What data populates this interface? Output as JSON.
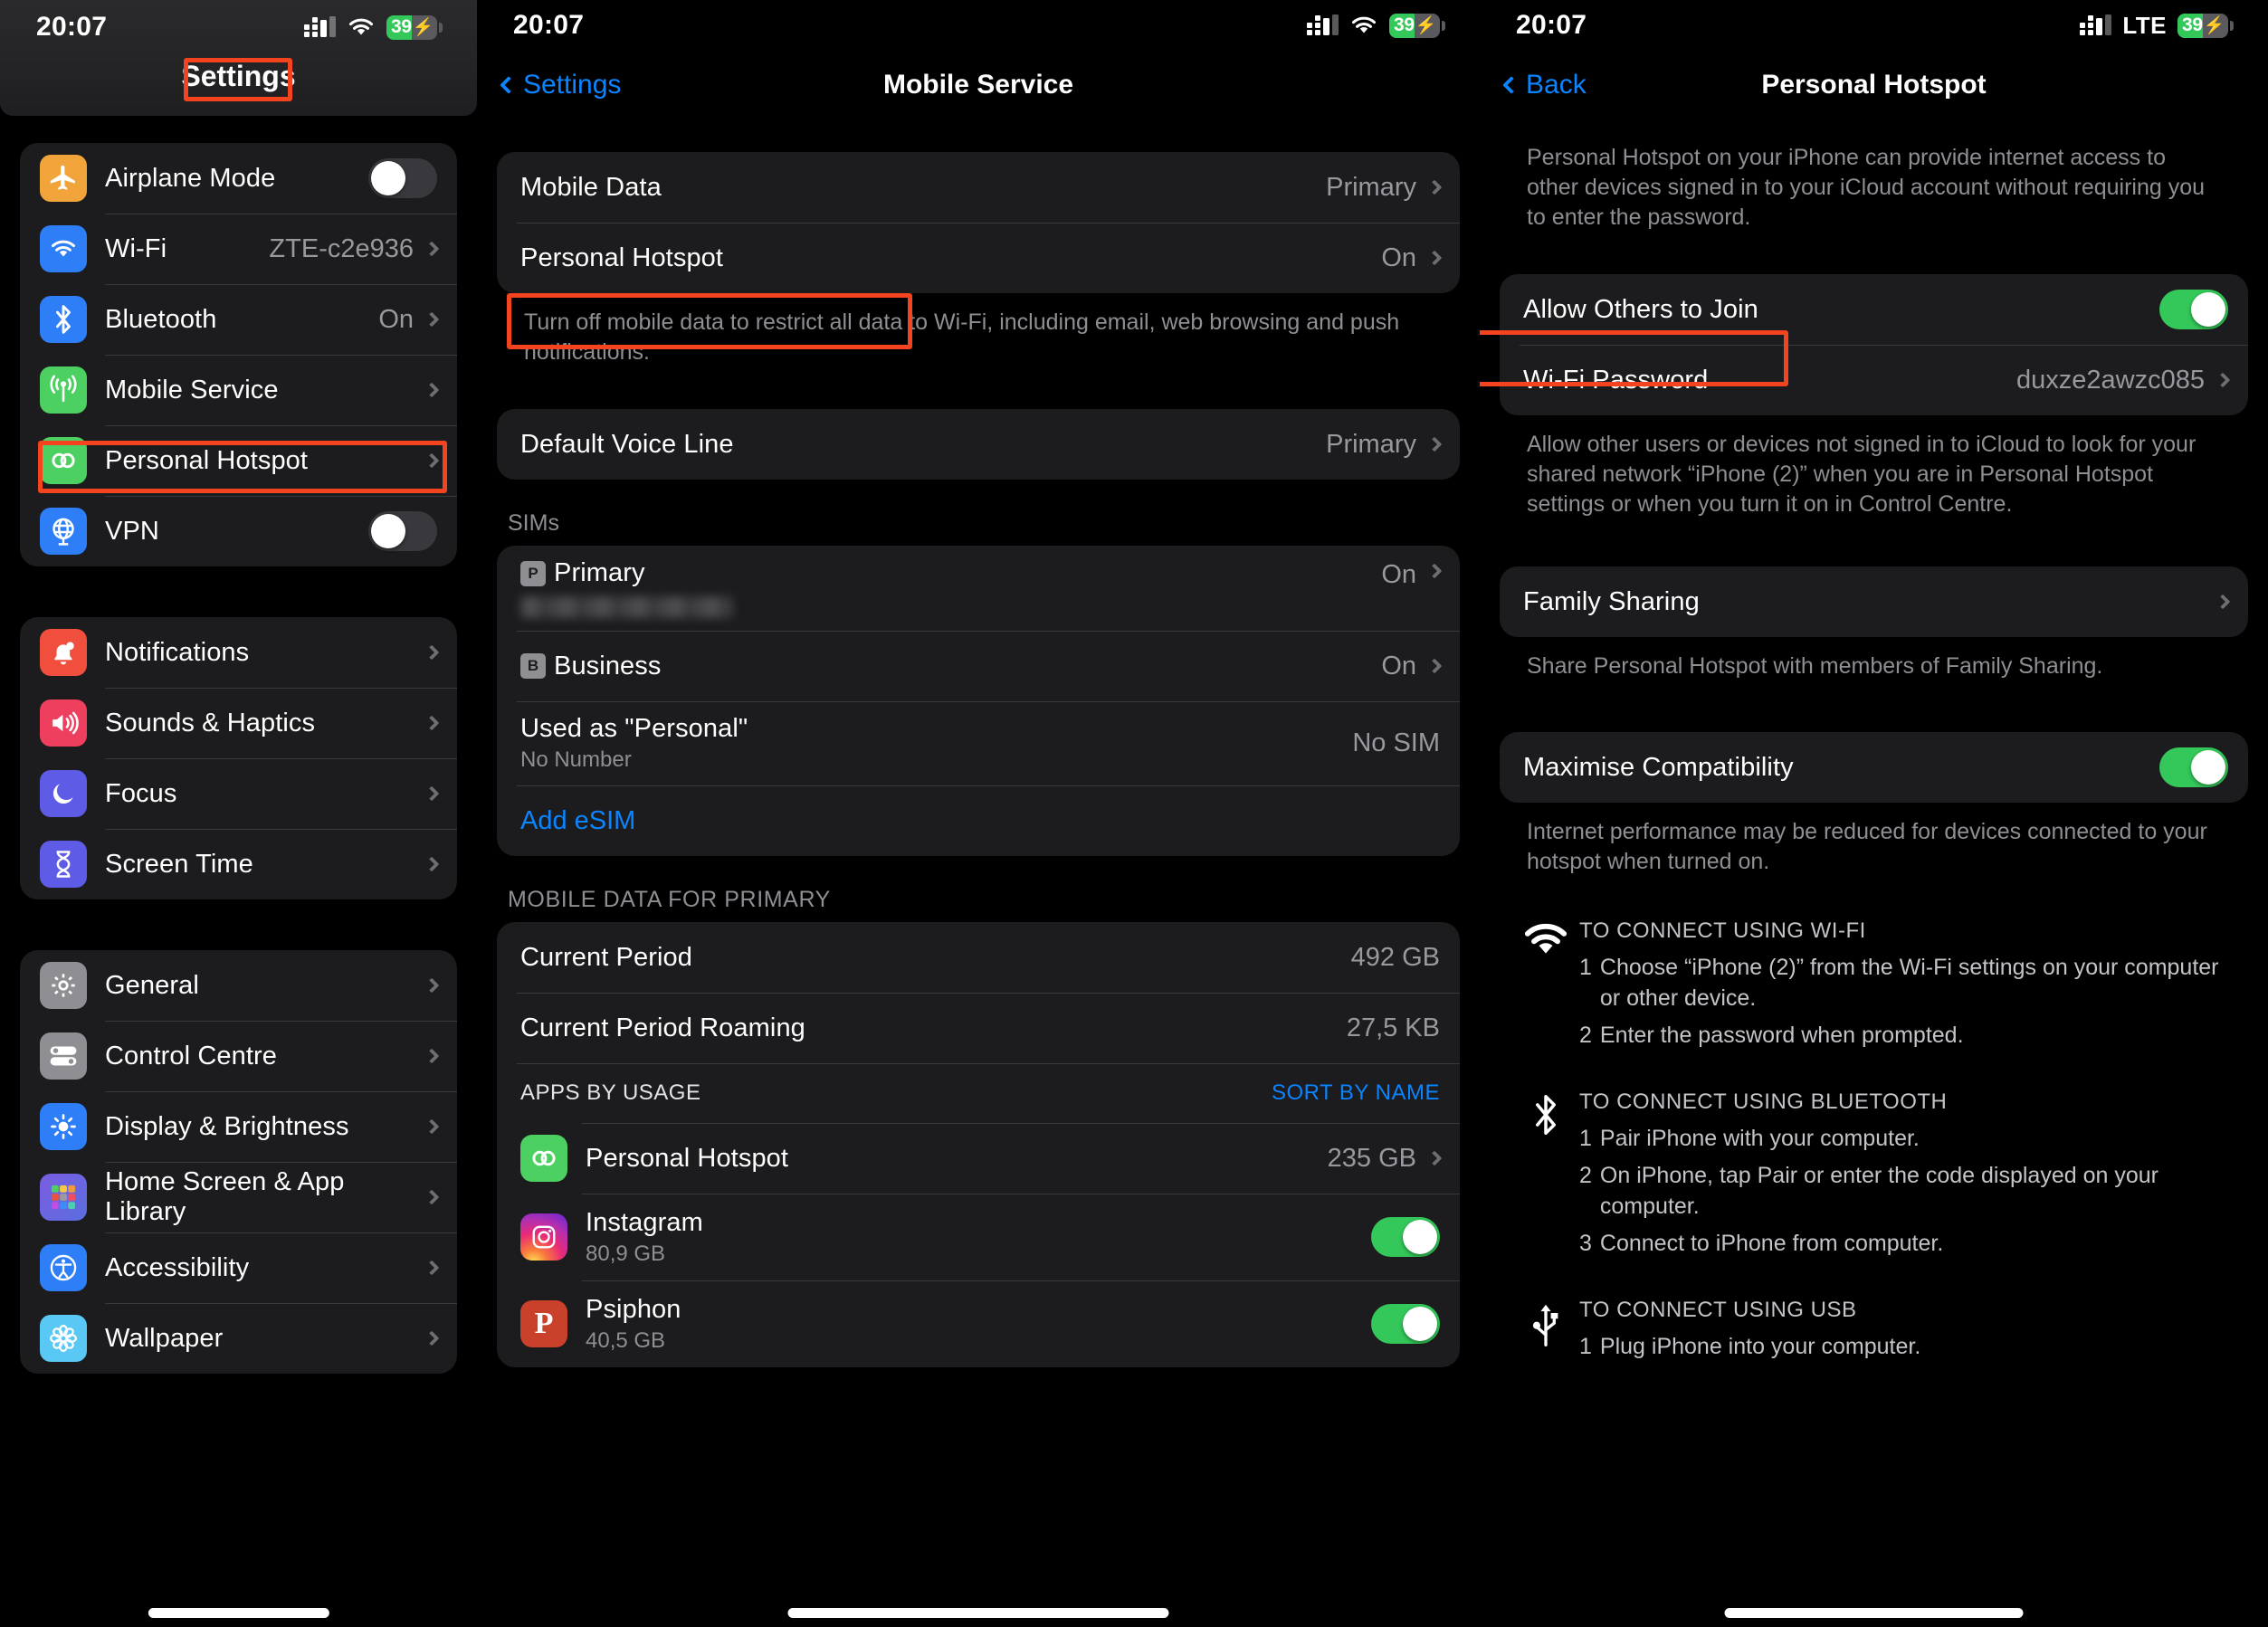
{
  "status_bar": {
    "time": "20:07",
    "battery_percent": "39",
    "battery_bolt": "⚡",
    "carrier_label_screen3": "LTE"
  },
  "screen1": {
    "title": "Settings",
    "groups": [
      {
        "rows": [
          {
            "label": "Airplane Mode",
            "icon": "airplane-icon",
            "icon_color": "#f0a43a",
            "control": "toggle",
            "toggle_on": false
          },
          {
            "label": "Wi-Fi",
            "icon": "wifi-icon",
            "icon_color": "#2e7ef7",
            "value": "ZTE-c2e936",
            "control": "chevron"
          },
          {
            "label": "Bluetooth",
            "icon": "bluetooth-icon",
            "icon_color": "#2e7ef7",
            "value": "On",
            "control": "chevron"
          },
          {
            "label": "Mobile Service",
            "icon": "cellular-antenna-icon",
            "icon_color": "#4cd061",
            "control": "chevron",
            "highlighted": true
          },
          {
            "label": "Personal Hotspot",
            "icon": "hotspot-link-icon",
            "icon_color": "#4cd061",
            "control": "chevron"
          },
          {
            "label": "VPN",
            "icon": "vpn-globe-icon",
            "icon_color": "#2e7ef7",
            "control": "toggle",
            "toggle_on": false
          }
        ]
      },
      {
        "rows": [
          {
            "label": "Notifications",
            "icon": "bell-icon",
            "icon_color": "#ef4f3c",
            "control": "chevron"
          },
          {
            "label": "Sounds & Haptics",
            "icon": "speaker-icon",
            "icon_color": "#ee3f5e",
            "control": "chevron"
          },
          {
            "label": "Focus",
            "icon": "moon-icon",
            "icon_color": "#5e5ce6",
            "control": "chevron"
          },
          {
            "label": "Screen Time",
            "icon": "hourglass-icon",
            "icon_color": "#5e5ce6",
            "control": "chevron"
          }
        ]
      },
      {
        "rows": [
          {
            "label": "General",
            "icon": "gear-icon",
            "icon_color": "#8e8e93",
            "control": "chevron"
          },
          {
            "label": "Control Centre",
            "icon": "sliders-icon",
            "icon_color": "#8e8e93",
            "control": "chevron"
          },
          {
            "label": "Display & Brightness",
            "icon": "brightness-icon",
            "icon_color": "#2e7ef7",
            "control": "chevron"
          },
          {
            "label": "Home Screen & App Library",
            "icon": "app-grid-icon",
            "icon_color": "#6a5ae0",
            "control": "chevron"
          },
          {
            "label": "Accessibility",
            "icon": "accessibility-icon",
            "icon_color": "#2e7ef7",
            "control": "chevron"
          },
          {
            "label": "Wallpaper",
            "icon": "flower-icon",
            "icon_color": "#5ac8f5",
            "control": "chevron"
          }
        ]
      }
    ]
  },
  "screen2": {
    "back_label": "Settings",
    "title": "Mobile Service",
    "group1": [
      {
        "label": "Mobile Data",
        "value": "Primary"
      },
      {
        "label": "Personal Hotspot",
        "value": "On",
        "highlighted": true
      }
    ],
    "footnote1": "Turn off mobile data to restrict all data to Wi-Fi, including email, web browsing and push notifications.",
    "group2": [
      {
        "label": "Default Voice Line",
        "value": "Primary"
      }
    ],
    "sims_header": "SIMs",
    "sims": [
      {
        "badge": "P",
        "label": "Primary",
        "value": "On",
        "redacted_number": true
      },
      {
        "badge": "B",
        "label": "Business",
        "value": "On"
      },
      {
        "label": "Used as \"Personal\"",
        "sub": "No Number",
        "value": "No SIM"
      }
    ],
    "add_esim": "Add eSIM",
    "data_header": "MOBILE DATA FOR PRIMARY",
    "data_rows": [
      {
        "label": "Current Period",
        "value": "492 GB"
      },
      {
        "label": "Current Period Roaming",
        "value": "27,5 KB"
      }
    ],
    "apps_header": "APPS BY USAGE",
    "apps_sort": "SORT BY NAME",
    "apps": [
      {
        "label": "Personal Hotspot",
        "value": "235 GB",
        "icon": "hotspot-link-icon",
        "control": "chevron"
      },
      {
        "label": "Instagram",
        "sub": "80,9 GB",
        "icon": "instagram-icon",
        "control": "toggle",
        "toggle_on": true
      },
      {
        "label": "Psiphon",
        "sub": "40,5 GB",
        "icon": "psiphon-icon",
        "control": "toggle",
        "toggle_on": true
      }
    ]
  },
  "screen3": {
    "back_label": "Back",
    "title": "Personal Hotspot",
    "intro": "Personal Hotspot on your iPhone can provide internet access to other devices signed in to your iCloud account without requiring you to enter the password.",
    "group1": [
      {
        "label": "Allow Others to Join",
        "control": "toggle",
        "toggle_on": true,
        "highlighted": true
      },
      {
        "label": "Wi-Fi Password",
        "value": "duxze2awzc085",
        "control": "chevron"
      }
    ],
    "footnote1": "Allow other users or devices not signed in to iCloud to look for your shared network “iPhone (2)” when you are in Personal Hotspot settings or when you turn it on in Control Centre.",
    "group2": [
      {
        "label": "Family Sharing",
        "control": "chevron"
      }
    ],
    "footnote2": "Share Personal Hotspot with members of Family Sharing.",
    "group3": [
      {
        "label": "Maximise Compatibility",
        "control": "toggle",
        "toggle_on": true
      }
    ],
    "footnote3": "Internet performance may be reduced for devices connected to your hotspot when turned on.",
    "instructions": [
      {
        "icon": "wifi-icon",
        "title": "TO CONNECT USING WI-FI",
        "steps": [
          {
            "n": "1",
            "text": "Choose “iPhone (2)” from the Wi-Fi settings on your computer or other device."
          },
          {
            "n": "2",
            "text": "Enter the password when prompted."
          }
        ]
      },
      {
        "icon": "bluetooth-icon",
        "title": "TO CONNECT USING BLUETOOTH",
        "steps": [
          {
            "n": "1",
            "text": "Pair iPhone with your computer."
          },
          {
            "n": "2",
            "text": "On iPhone, tap Pair or enter the code displayed on your computer."
          },
          {
            "n": "3",
            "text": "Connect to iPhone from computer."
          }
        ]
      },
      {
        "icon": "usb-icon",
        "title": "TO CONNECT USING USB",
        "steps": [
          {
            "n": "1",
            "text": "Plug iPhone into your computer."
          }
        ]
      }
    ]
  },
  "colors": {
    "accent_blue": "#0a84ff",
    "toggle_green": "#34c759",
    "highlight_red": "#f4441f",
    "group_bg": "#1c1c1e",
    "secondary_text": "#8e8e93"
  }
}
